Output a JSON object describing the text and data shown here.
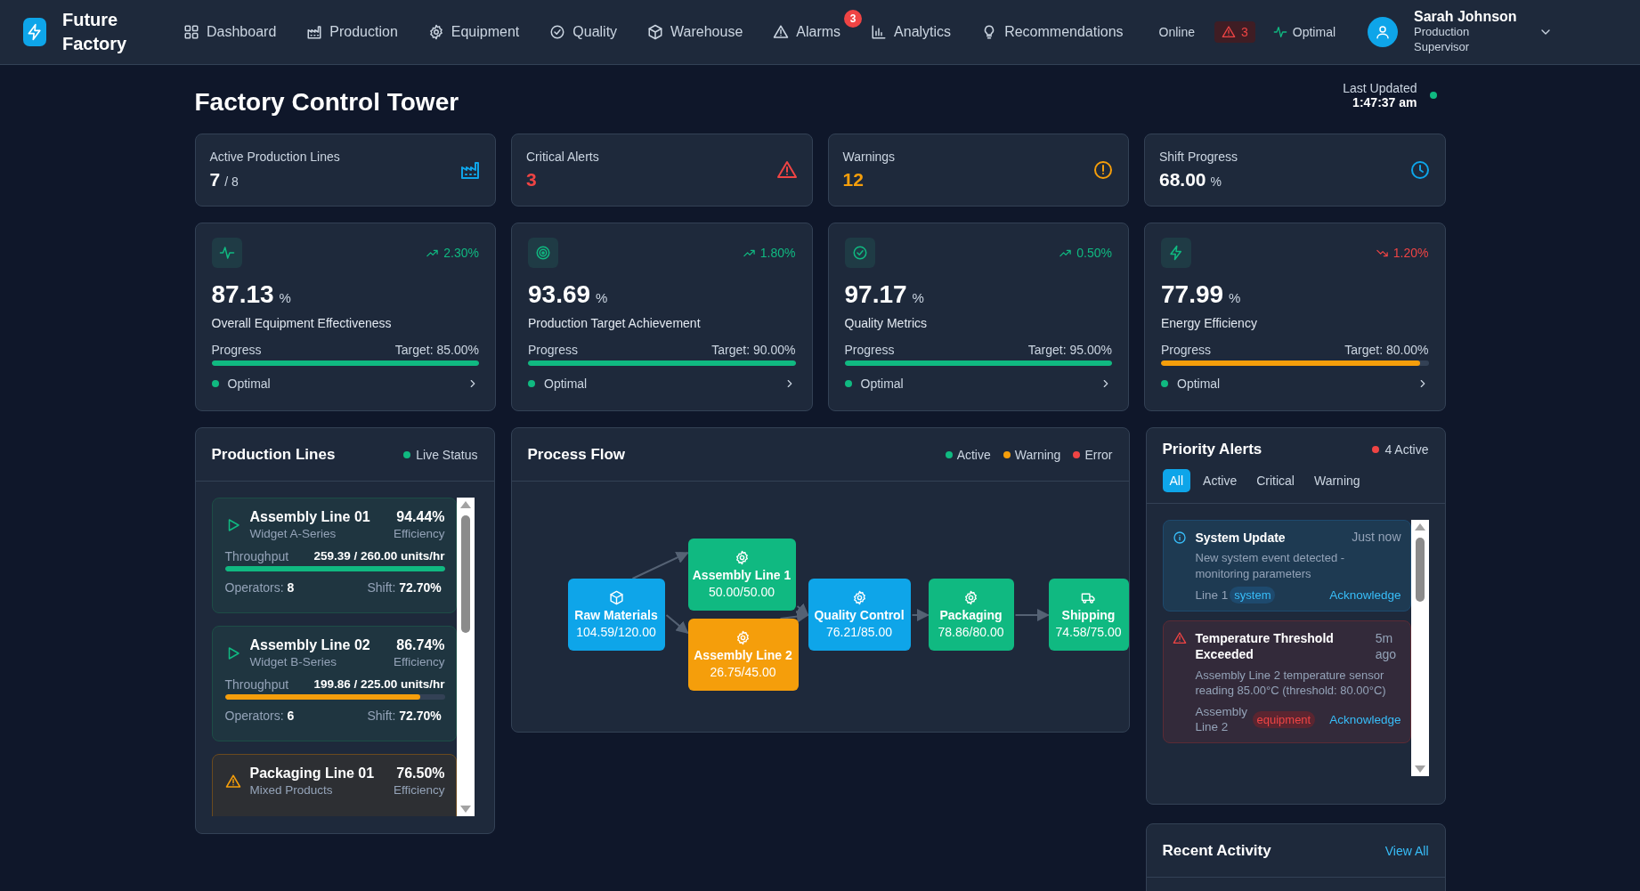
{
  "nav": {
    "brand": "Future Factory",
    "items": [
      {
        "label": "Dashboard"
      },
      {
        "label": "Production"
      },
      {
        "label": "Equipment"
      },
      {
        "label": "Quality"
      },
      {
        "label": "Warehouse"
      },
      {
        "label": "Alarms",
        "badge": "3"
      },
      {
        "label": "Analytics"
      },
      {
        "label": "Recommendations"
      }
    ],
    "connection": "Online",
    "alert_count": "3",
    "system_status": "Optimal",
    "user": {
      "name": "Sarah Johnson",
      "role": "Production Supervisor"
    }
  },
  "header": {
    "title": "Factory Control Tower",
    "updated_label": "Last Updated",
    "updated_time": "1:47:37 am",
    "live": true
  },
  "kpis": [
    {
      "label": "Active Production Lines",
      "value": "7",
      "suffix": "/ 8",
      "kind": "normal"
    },
    {
      "label": "Critical Alerts",
      "value": "3",
      "kind": "critical"
    },
    {
      "label": "Warnings",
      "value": "12",
      "kind": "warning"
    },
    {
      "label": "Shift Progress",
      "value": "68.00",
      "suffix": "%",
      "kind": "normal"
    }
  ],
  "metrics": [
    {
      "value": "87.13",
      "unit": "%",
      "trend": "2.30%",
      "trend_up": true,
      "label": "Overall Equipment Effectiveness",
      "progress_label": "Progress",
      "target": "Target: 85.00%",
      "level": 1,
      "below_target": false,
      "status": "Optimal"
    },
    {
      "value": "93.69",
      "unit": "%",
      "trend": "1.80%",
      "trend_up": true,
      "label": "Production Target Achievement",
      "progress_label": "Progress",
      "target": "Target: 90.00%",
      "level": 1,
      "below_target": false,
      "status": "Optimal"
    },
    {
      "value": "97.17",
      "unit": "%",
      "trend": "0.50%",
      "trend_up": true,
      "label": "Quality Metrics",
      "progress_label": "Progress",
      "target": "Target: 95.00%",
      "level": 1,
      "below_target": false,
      "status": "Optimal"
    },
    {
      "value": "77.99",
      "unit": "%",
      "trend": "1.20%",
      "trend_up": false,
      "label": "Energy Efficiency",
      "progress_label": "Progress",
      "target": "Target: 80.00%",
      "level": 0.97,
      "below_target": true,
      "status": "Optimal"
    }
  ],
  "production_lines": {
    "title": "Production Lines",
    "live_label": "Live Status",
    "lines": [
      {
        "name": "Assembly Line 01",
        "product": "Widget A-Series",
        "efficiency": "94.44%",
        "efficiency_label": "Efficiency",
        "warning": false,
        "throughput_label": "Throughput",
        "throughput": "259.39 / 260.00 units/hr",
        "level": 1,
        "operators_label": "Operators:",
        "operators": "8",
        "shift_label": "Shift:",
        "shift": "72.70%"
      },
      {
        "name": "Assembly Line 02",
        "product": "Widget B-Series",
        "efficiency": "86.74%",
        "efficiency_label": "Efficiency",
        "warning": false,
        "throughput_label": "Throughput",
        "throughput": "199.86 / 225.00 units/hr",
        "level": 0.89,
        "operators_label": "Operators:",
        "operators": "6",
        "shift_label": "Shift:",
        "shift": "72.70%"
      },
      {
        "name": "Packaging Line 01",
        "product": "Mixed Products",
        "efficiency": "76.50%",
        "efficiency_label": "Efficiency",
        "warning": true
      }
    ]
  },
  "process_flow": {
    "title": "Process Flow",
    "legend": [
      {
        "label": "Active",
        "color": "#10b981"
      },
      {
        "label": "Warning",
        "color": "#f59e0b"
      },
      {
        "label": "Error",
        "color": "#ef4444"
      }
    ],
    "nodes": [
      {
        "label": "Raw Materials",
        "value": "104.59/120.00",
        "kind": "materials",
        "color": "#0ea5e9"
      },
      {
        "label": "Assembly Line 1",
        "value": "50.00/50.00",
        "kind": "process",
        "color": "#10b981"
      },
      {
        "label": "Assembly Line 2",
        "value": "26.75/45.00",
        "kind": "process",
        "color": "#f59e0b"
      },
      {
        "label": "Quality Control",
        "value": "76.21/85.00",
        "kind": "process",
        "color": "#0ea5e9"
      },
      {
        "label": "Packaging",
        "value": "78.86/80.00",
        "kind": "process",
        "color": "#10b981"
      },
      {
        "label": "Shipping",
        "value": "74.58/75.00",
        "kind": "shipping",
        "color": "#10b981"
      }
    ]
  },
  "priority_alerts": {
    "title": "Priority Alerts",
    "count": "4 Active",
    "filters": [
      {
        "label": "All",
        "selected": true
      },
      {
        "label": "Active",
        "selected": false
      },
      {
        "label": "Critical",
        "selected": false
      },
      {
        "label": "Warning",
        "selected": false
      }
    ],
    "alerts": [
      {
        "kind": "info",
        "title": "System Update",
        "time": "Just now",
        "message": "New system event detected - monitoring parameters",
        "source": "Line 1",
        "tag": "system",
        "action": "Acknowledge"
      },
      {
        "kind": "critical",
        "title": "Temperature Threshold Exceeded",
        "time": "5m ago",
        "message": "Assembly Line 2 temperature sensor reading 85.00°C (threshold: 80.00°C)",
        "source": "Assembly Line 2",
        "tag": "equipment",
        "action": "Acknowledge"
      }
    ]
  },
  "recent_activity": {
    "title": "Recent Activity",
    "link": "View All"
  }
}
